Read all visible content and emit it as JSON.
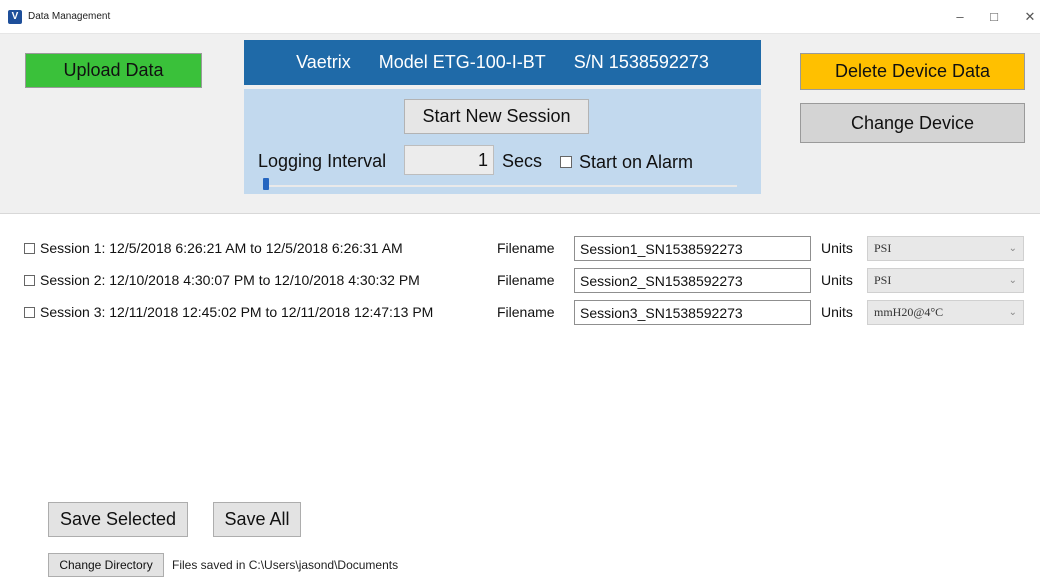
{
  "window": {
    "title": "Data Management",
    "icon": "vaetrix-app-icon",
    "minimize": "–",
    "maximize": "□",
    "close": "✕"
  },
  "device": {
    "brand": "Vaetrix",
    "model": "Model ETG-100-I-BT",
    "serial": "S/N 1538592273"
  },
  "buttons": {
    "upload": "Upload Data",
    "delete": "Delete Device Data",
    "change_device": "Change Device",
    "start_session": "Start New Session",
    "save_selected": "Save Selected",
    "save_all": "Save All",
    "change_directory": "Change Directory"
  },
  "logging": {
    "label": "Logging Interval",
    "value": "1",
    "unit": "Secs",
    "alarm_label": "Start on Alarm",
    "alarm_checked": false,
    "slider_fraction": 0.0
  },
  "sessions": [
    {
      "label": "Session 1: 12/5/2018 6:26:21 AM to 12/5/2018 6:26:31 AM",
      "filename_label": "Filename",
      "filename": "Session1_SN1538592273",
      "units_label": "Units",
      "units": "PSI",
      "checked": false
    },
    {
      "label": "Session 2: 12/10/2018 4:30:07 PM to 12/10/2018 4:30:32 PM",
      "filename_label": "Filename",
      "filename": "Session2_SN1538592273",
      "units_label": "Units",
      "units": "PSI",
      "checked": false
    },
    {
      "label": "Session 3: 12/11/2018 12:45:02 PM to 12/11/2018 12:47:13 PM",
      "filename_label": "Filename",
      "filename": "Session3_SN1538592273",
      "units_label": "Units",
      "units": "mmH20@4°C",
      "checked": false
    }
  ],
  "directory": {
    "text": "Files saved in C:\\Users\\jasond\\Documents"
  },
  "colors": {
    "upload": "#3ac13a",
    "delete": "#ffc000",
    "header": "#1f6aa8",
    "session_panel": "#c2d9ee",
    "slider_thumb": "#2566c0"
  }
}
